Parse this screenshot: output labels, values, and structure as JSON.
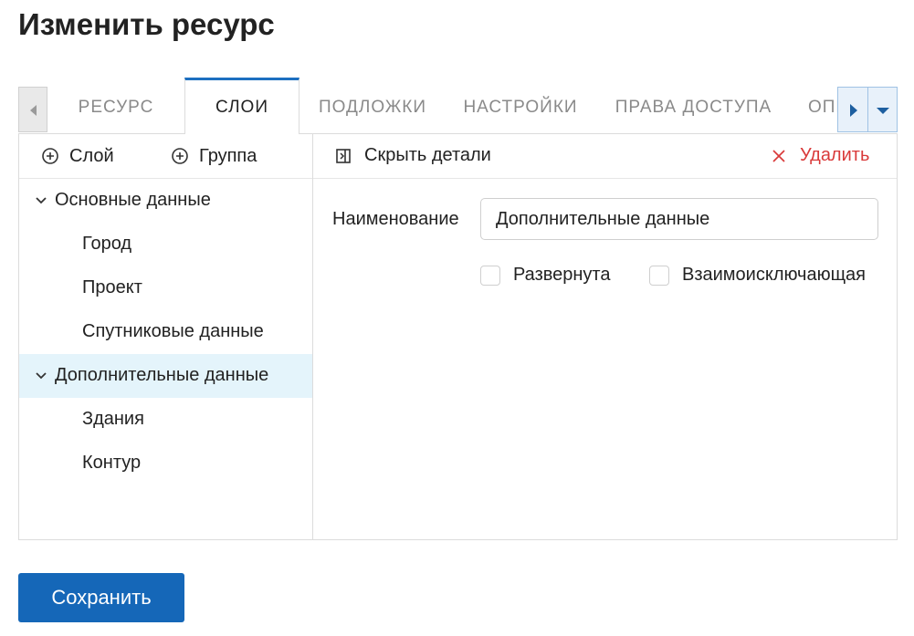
{
  "page": {
    "title": "Изменить ресурс"
  },
  "tabs": [
    {
      "label": "РЕСУРС",
      "active": false
    },
    {
      "label": "СЛОИ",
      "active": true
    },
    {
      "label": "ПОДЛОЖКИ",
      "active": false
    },
    {
      "label": "НАСТРОЙКИ",
      "active": false
    },
    {
      "label": "ПРАВА ДОСТУПА",
      "active": false
    },
    {
      "label": "ОПИСАНИЕ",
      "active": false
    }
  ],
  "tree_toolbar": {
    "add_layer": "Слой",
    "add_group": "Группа"
  },
  "tree": [
    {
      "label": "Основные данные",
      "type": "group",
      "expanded": true
    },
    {
      "label": "Город",
      "type": "layer"
    },
    {
      "label": "Проект",
      "type": "layer"
    },
    {
      "label": "Спутниковые данные",
      "type": "layer"
    },
    {
      "label": "Дополнительные данные",
      "type": "group",
      "expanded": true,
      "selected": true
    },
    {
      "label": "Здания",
      "type": "layer"
    },
    {
      "label": "Контур",
      "type": "layer"
    }
  ],
  "details": {
    "hide_details": "Скрыть детали",
    "delete": "Удалить",
    "name_label": "Наименование",
    "name_value": "Дополнительные данные",
    "expanded_label": "Развернута",
    "expanded_checked": false,
    "exclusive_label": "Взаимоисключающая",
    "exclusive_checked": false
  },
  "actions": {
    "save": "Сохранить"
  },
  "colors": {
    "accent": "#1567b8",
    "danger": "#d93a3a",
    "selected_bg": "#e4f4fb"
  }
}
